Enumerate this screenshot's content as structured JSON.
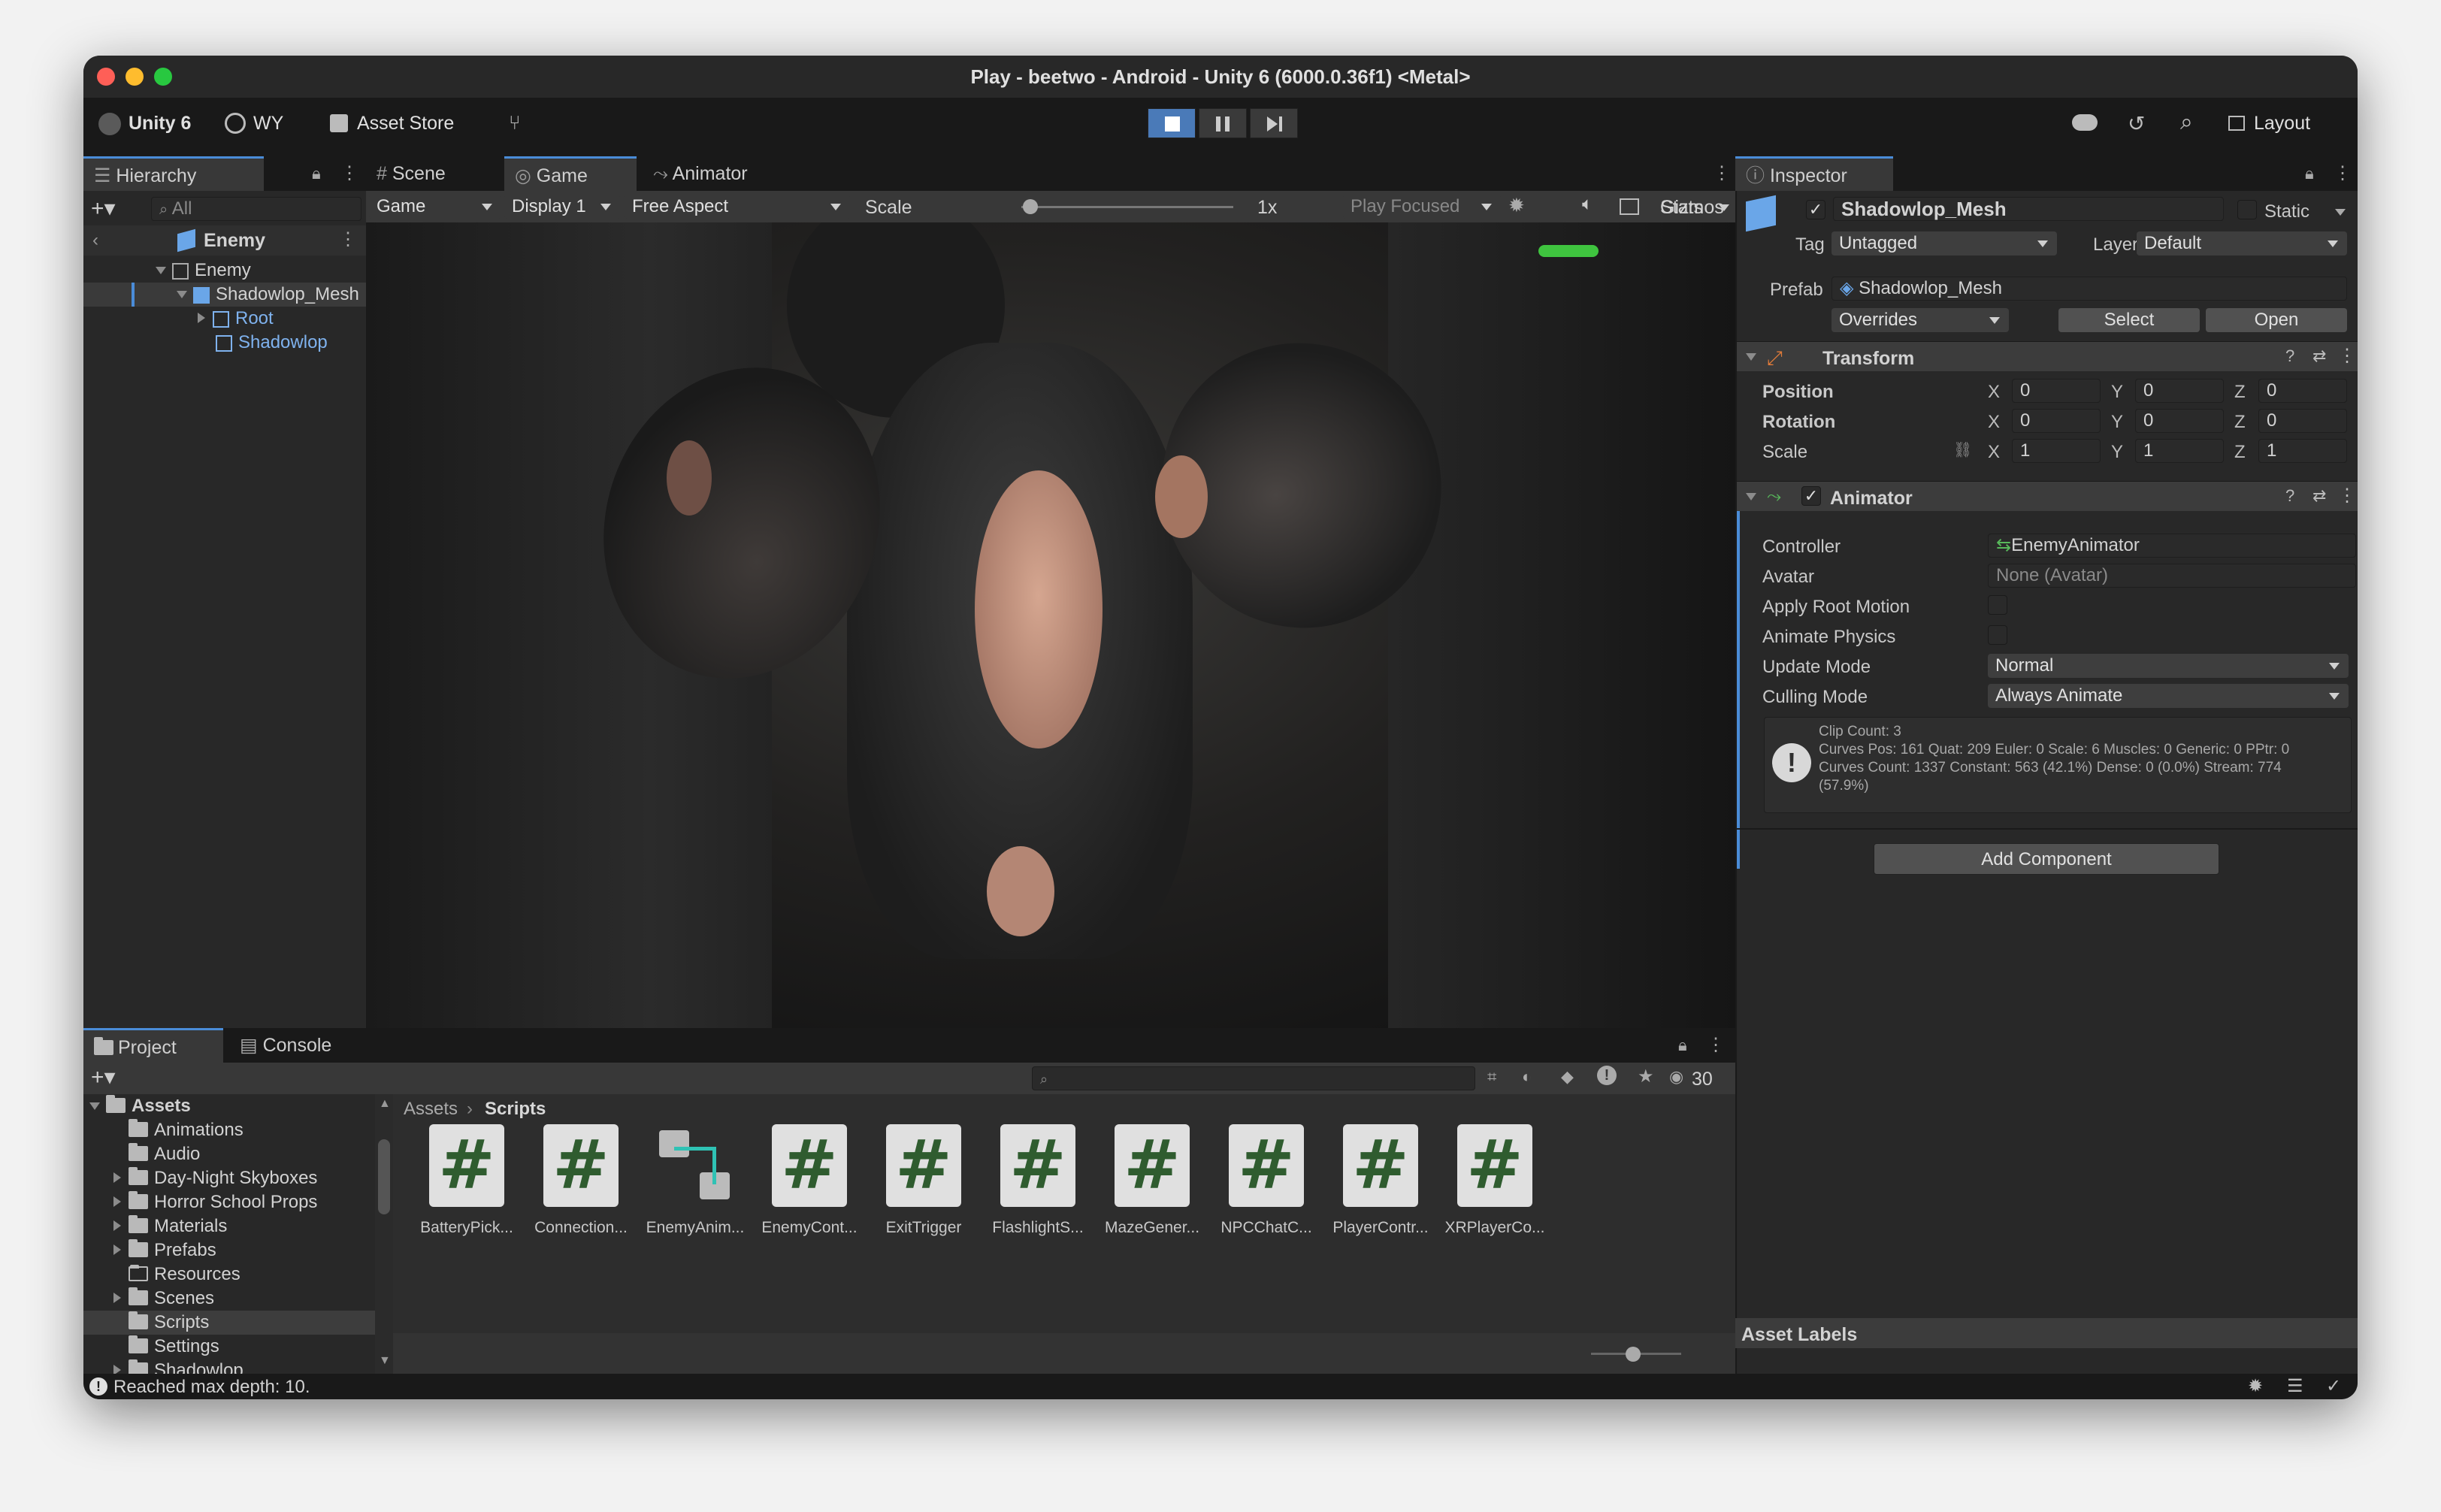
{
  "window": {
    "title": "Play - beetwo - Android - Unity 6 (6000.0.36f1) <Metal>"
  },
  "toolbar": {
    "unity_label": "Unity 6",
    "account": "WY",
    "asset_store": "Asset Store",
    "layout": "Layout"
  },
  "hierarchy": {
    "tab": "Hierarchy",
    "search_placeholder": "All",
    "scene": "Enemy",
    "items": [
      "Enemy",
      "Shadowlop_Mesh",
      "Root",
      "Shadowlop"
    ]
  },
  "tabs": {
    "scene": "Scene",
    "game": "Game",
    "animator": "Animator"
  },
  "game_bar": {
    "mode": "Game",
    "display": "Display 1",
    "aspect": "Free Aspect",
    "scale_label": "Scale",
    "scale_value": "1x",
    "play_mode": "Play Focused",
    "stats": "Stats",
    "gizmos": "Gizmos"
  },
  "project": {
    "tab": "Project",
    "console_tab": "Console",
    "count": "30",
    "root": "Assets",
    "folders": [
      "Animations",
      "Audio",
      "Day-Night Skyboxes",
      "Horror School Props",
      "Materials",
      "Prefabs",
      "Resources",
      "Scenes",
      "Scripts",
      "Settings",
      "Shadowlop"
    ],
    "breadcrumb": [
      "Assets",
      "Scripts"
    ],
    "assets": [
      "BatteryPick...",
      "Connection...",
      "EnemyAnim...",
      "EnemyCont...",
      "ExitTrigger",
      "FlashlightS...",
      "MazeGener...",
      "NPCChatC...",
      "PlayerContr...",
      "XRPlayerCo..."
    ]
  },
  "status": {
    "message": "Reached max depth: 10."
  },
  "inspector": {
    "tab": "Inspector",
    "object_name": "Shadowlop_Mesh",
    "static_label": "Static",
    "tag_label": "Tag",
    "tag_value": "Untagged",
    "layer_label": "Layer",
    "layer_value": "Default",
    "prefab_label": "Prefab",
    "prefab_value": "Shadowlop_Mesh",
    "overrides": "Overrides",
    "select": "Select",
    "open": "Open",
    "transform": {
      "title": "Transform",
      "position_label": "Position",
      "rotation_label": "Rotation",
      "scale_label": "Scale",
      "axis_x": "X",
      "axis_y": "Y",
      "axis_z": "Z",
      "position": [
        "0",
        "0",
        "0"
      ],
      "rotation": [
        "0",
        "0",
        "0"
      ],
      "scale": [
        "1",
        "1",
        "1"
      ]
    },
    "animator": {
      "title": "Animator",
      "controller_label": "Controller",
      "controller_value": "EnemyAnimator",
      "avatar_label": "Avatar",
      "avatar_value": "None (Avatar)",
      "apply_root_motion": "Apply Root Motion",
      "animate_physics": "Animate Physics",
      "update_mode_label": "Update Mode",
      "update_mode_value": "Normal",
      "culling_mode_label": "Culling Mode",
      "culling_mode_value": "Always Animate",
      "info_1": "Clip Count: 3",
      "info_2": "Curves Pos: 161 Quat: 209 Euler: 0 Scale: 6 Muscles: 0 Generic: 0 PPtr: 0",
      "info_3": "Curves Count: 1337 Constant: 563 (42.1%) Dense: 0 (0.0%) Stream: 774",
      "info_4": "(57.9%)"
    },
    "add_component": "Add Component",
    "asset_labels": "Asset Labels"
  }
}
